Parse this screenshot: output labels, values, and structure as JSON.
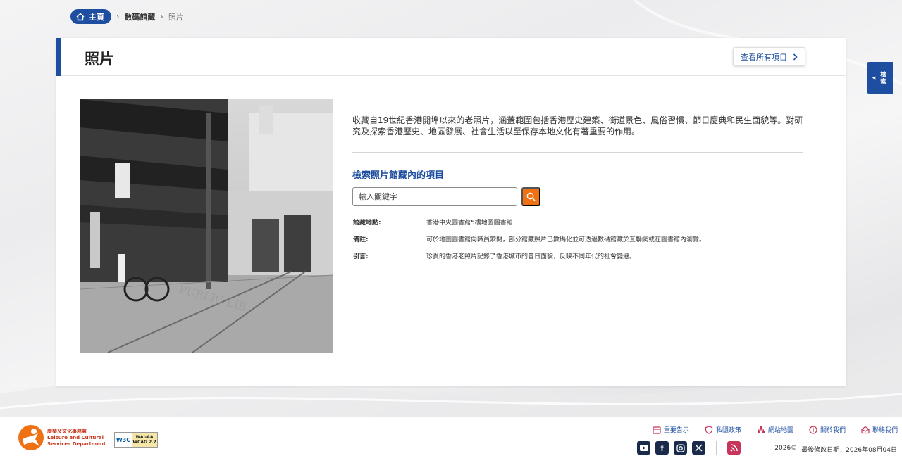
{
  "breadcrumb": {
    "home": "主頁",
    "section": "數碼館藏",
    "current": "照片"
  },
  "page": {
    "title": "照片",
    "view_all": "查看所有項目",
    "description": "收藏自19世紀香港開埠以來的老照片，涵蓋範圍包括香港歷史建築、街道景色、風俗習慣、節日慶典和民生面貌等。對研究及探索香港歷史、地區發展、社會生活以至保存本地文化有著重要的作用。",
    "search_heading": "檢索照片館藏內的項目",
    "search_placeholder": "輸入關鍵字"
  },
  "info": [
    {
      "label": "館藏地點:",
      "value": "香港中央圖書館5樓地圖圖書館"
    },
    {
      "label": "備註:",
      "value": "可於地圖圖書館向職員索閱，部分館藏照片已數碼化並可透過數碼館藏於互聯網或在圖書館內瀏覽。"
    },
    {
      "label": "引言:",
      "value": "珍貴的香港老照片記錄了香港城市的昔日面貌，反映不同年代的社會變遷。"
    }
  ],
  "side_tab": {
    "label": "檢索"
  },
  "footer": {
    "logo_cn": "康樂及文化事務署",
    "logo_en1": "Leisure and Cultural",
    "logo_en2": "Services Department",
    "wcag_line1": "WAI-AA",
    "wcag_line2": "WCAG 2.2",
    "wcag_org": "W3C",
    "links": [
      "重要告示",
      "私隱政策",
      "網站地圖",
      "關於我們",
      "聯絡我們"
    ],
    "copyright": "2026©",
    "last_updated": "最後修改日期：2026年08月04日"
  },
  "colors": {
    "primary": "#1e4ea0",
    "accent": "#f07014"
  }
}
